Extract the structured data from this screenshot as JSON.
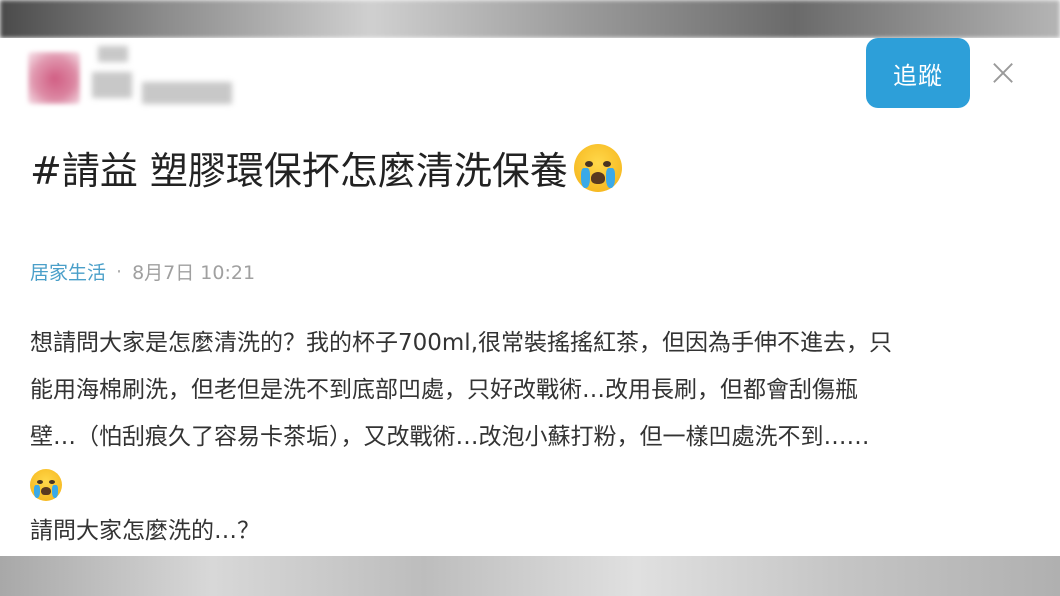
{
  "post": {
    "follow_label": "追蹤",
    "close_glyph": "×",
    "title": "#請益 塑膠環保抔怎麼清洗保養",
    "title_emoji": "loudly-crying-face",
    "category": "居家生活",
    "separator": "·",
    "date": "8月7日 10:21",
    "body_lines": [
      "想請問大家是怎麼清洗的？我的杯子700ml,很常裝搖搖紅茶，但因為手伸不進去，只",
      "能用海棉刷洗，但老但是洗不到底部凹處，只好改戰術…改用長刷，但都會刮傷瓶",
      "壁…（怕刮痕久了容易卡茶垢），又改戰術…改泡小蘇打粉，但一樣凹處洗不到……"
    ],
    "body_emoji": "loudly-crying-face",
    "body_last_line": "請問大家怎麼洗的…？"
  },
  "colors": {
    "follow_button": "#2d9fd9",
    "category_link": "#4a9fc9",
    "text": "#333333",
    "meta": "#a0a0a0"
  }
}
